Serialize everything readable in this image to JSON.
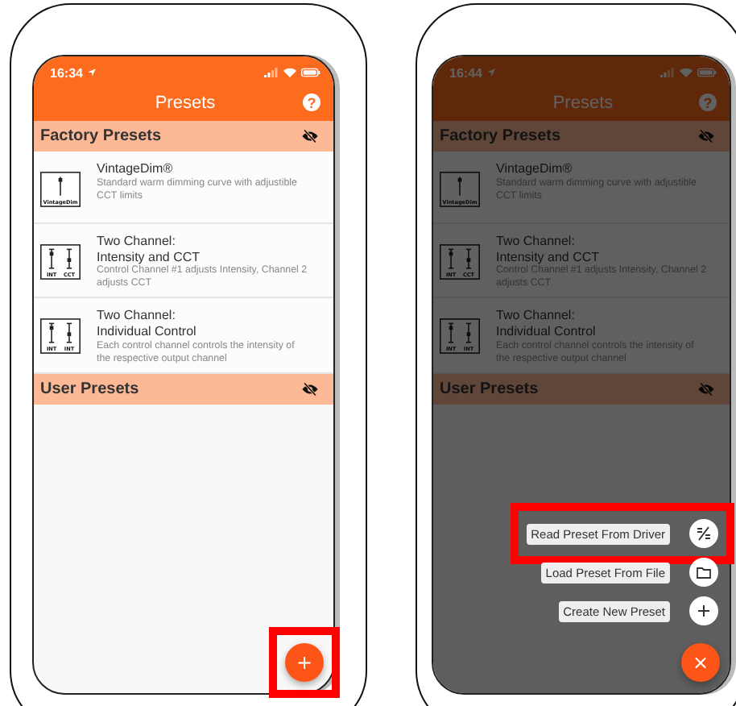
{
  "phones": [
    {
      "status_time": "16:34",
      "title": "Presets",
      "help": "?",
      "menu_open": false,
      "sections": [
        {
          "title": "Factory Presets",
          "items": [
            {
              "kind": "single",
              "icon_labels": [
                "VintageDim"
              ],
              "title": "VintageDim®",
              "description": "Standard warm dimming curve with adjustible CCT limits"
            },
            {
              "kind": "dual",
              "icon_labels": [
                "INT",
                "CCT"
              ],
              "title": "Two Channel:\nIntensity and CCT",
              "description": "Control Channel #1 adjusts Intensity, Channel 2 adjusts CCT"
            },
            {
              "kind": "dual",
              "icon_labels": [
                "INT",
                "INT"
              ],
              "title": "Two Channel:\nIndividual Control",
              "description": "Each control channel controls the intensity of the respective output channel"
            }
          ]
        },
        {
          "title": "User Presets"
        }
      ],
      "fab": {
        "symbol": "+",
        "highlighted": true
      }
    },
    {
      "status_time": "16:44",
      "title": "Presets",
      "help": "?",
      "menu_open": true,
      "sections": [
        {
          "title": "Factory Presets",
          "items": [
            {
              "kind": "single",
              "icon_labels": [
                "VintageDim"
              ],
              "title": "VintageDim®",
              "description": "Standard warm dimming curve with adjustible CCT limits"
            },
            {
              "kind": "dual",
              "icon_labels": [
                "INT",
                "CCT"
              ],
              "title": "Two Channel:\nIntensity and CCT",
              "description": "Control Channel #1 adjusts Intensity, Channel 2 adjusts CCT"
            },
            {
              "kind": "dual",
              "icon_labels": [
                "INT",
                "INT"
              ],
              "title": "Two Channel:\nIndividual Control",
              "description": "Each control channel controls the intensity of the respective output channel"
            }
          ]
        },
        {
          "title": "User Presets"
        }
      ],
      "menu": [
        {
          "label": "Read Preset From Driver",
          "kind": "read",
          "highlighted": true
        },
        {
          "label": "Load Preset From File",
          "kind": "folder",
          "highlighted": false
        },
        {
          "label": "Create New Preset",
          "kind": "plus",
          "highlighted": false
        }
      ],
      "fab": {
        "symbol": "×",
        "highlighted": false
      }
    }
  ]
}
